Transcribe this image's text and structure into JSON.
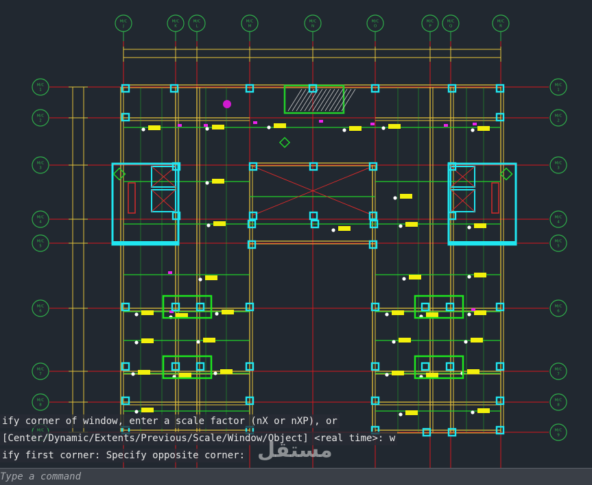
{
  "command_history": [
    "ify corner of window, enter a scale factor (nX or nXP), or",
    "[Center/Dynamic/Extents/Previous/Scale/Window/Object] <real time>: w",
    "ify first corner: Specify opposite corner:"
  ],
  "command_input": {
    "placeholder": "Type a command"
  },
  "watermark": "مستقل",
  "grid_bubbles_top": [
    "M/C J",
    "M/C K",
    "M/C L",
    "M/C M",
    "M/C N",
    "M/C O",
    "M/C P",
    "M/C Q",
    "M/C R"
  ],
  "grid_bubbles_side": [
    "M/C 1",
    "M/C 2",
    "M/C 3",
    "M/C 4",
    "M/C 5",
    "M/C 6",
    "M/C 7",
    "M/C 8",
    "M/C 9"
  ],
  "colors": {
    "background": "#212830",
    "grid_line": "#d8181e",
    "bubble": "#2fae4a",
    "wall": "#e7c33a",
    "column": "#20e6f0",
    "beam": "#22d12a",
    "label": "#f3f00c",
    "marker": "#ee22ee"
  }
}
